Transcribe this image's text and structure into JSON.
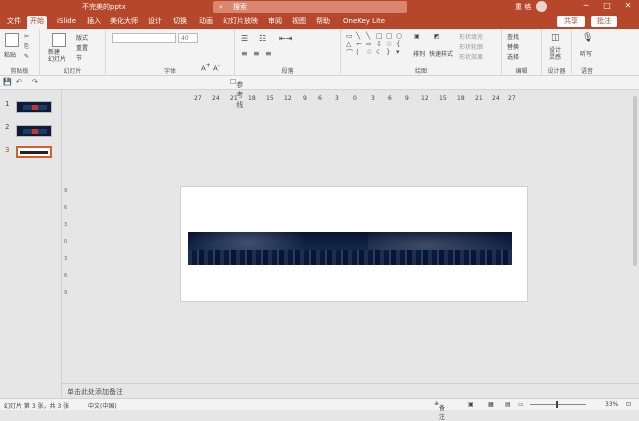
{
  "titlebar": {
    "doc_name": "不完美的pptx",
    "search_placeholder": "搜索",
    "user": "重 格",
    "minimize": "─",
    "maximize": "□",
    "close": "✕"
  },
  "tabs": [
    "文件",
    "开始",
    "iSlide",
    "插入",
    "美化大师",
    "设计",
    "切换",
    "动画",
    "幻灯片放映",
    "审阅",
    "视图",
    "帮助",
    "OneKey Lite"
  ],
  "active_tab": "开始",
  "share_label": "共享",
  "comment_label": "批注",
  "ribbon": {
    "clipboard": {
      "paste": "粘贴",
      "label": "剪贴板"
    },
    "slides": {
      "new_slide": "新建\n幻灯片",
      "layout": "版式",
      "reset": "重置",
      "section": "节",
      "label": "幻灯片"
    },
    "font": {
      "font_name": "",
      "font_size": "40",
      "bold": "B",
      "italic": "I",
      "underline": "U",
      "strike": "S",
      "label": "字体"
    },
    "paragraph": {
      "label": "段落"
    },
    "drawing": {
      "arrange": "排列",
      "quick_styles": "快速样式",
      "fill": "形状填充",
      "outline": "形状轮廓",
      "effects": "形状效果",
      "label": "绘图"
    },
    "editing": {
      "find": "查找",
      "replace": "替换",
      "select": "选择",
      "label": "编辑"
    },
    "designer": {
      "design_ideas": "设计\n灵感",
      "label": "设计器"
    },
    "voice": {
      "dictate": "听写",
      "label": "语音"
    }
  },
  "qat": {
    "save": "💾",
    "undo": "↶",
    "redo": "↷",
    "new_group": "参考线"
  },
  "thumbnails": [
    {
      "num": "1"
    },
    {
      "num": "2"
    },
    {
      "num": "3"
    }
  ],
  "hruler": [
    "27",
    "24",
    "21",
    "18",
    "15",
    "12",
    "9",
    "6",
    "3",
    "0",
    "3",
    "6",
    "9",
    "12",
    "15",
    "18",
    "21",
    "24",
    "27"
  ],
  "vruler": [
    "9",
    "6",
    "3",
    "0",
    "3",
    "6",
    "9"
  ],
  "notes_placeholder": "单击此处添加备注",
  "status": {
    "slide_info": "幻灯片 第 3 张，共 3 张",
    "language": "中文(中国)",
    "notes": "备注",
    "zoom": "33%"
  }
}
